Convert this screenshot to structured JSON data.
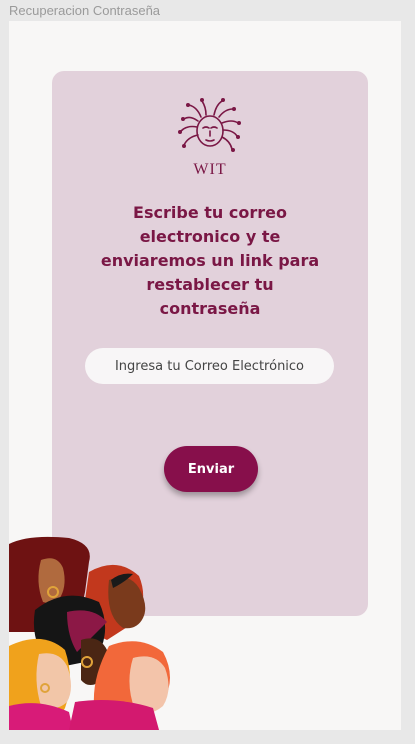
{
  "frame": {
    "title": "Recuperacion Contraseña"
  },
  "logo": {
    "text": "WIT"
  },
  "form": {
    "headline": "Escribe tu correo\nelectronico y  te\nenviaremos  un link para\nrestablecer tu\ncontraseña",
    "email_placeholder": "Ingresa tu Correo Electrónico",
    "email_value": "",
    "submit_label": "Enviar"
  },
  "colors": {
    "brand": "#870f4b",
    "card_background": "#e2d1db",
    "page_background": "#f8f7f6",
    "text_accent": "#7a1745"
  },
  "icons": {
    "logo_icon": "medusa-circuit-face-icon",
    "illustration": "group-of-women-illustration"
  }
}
